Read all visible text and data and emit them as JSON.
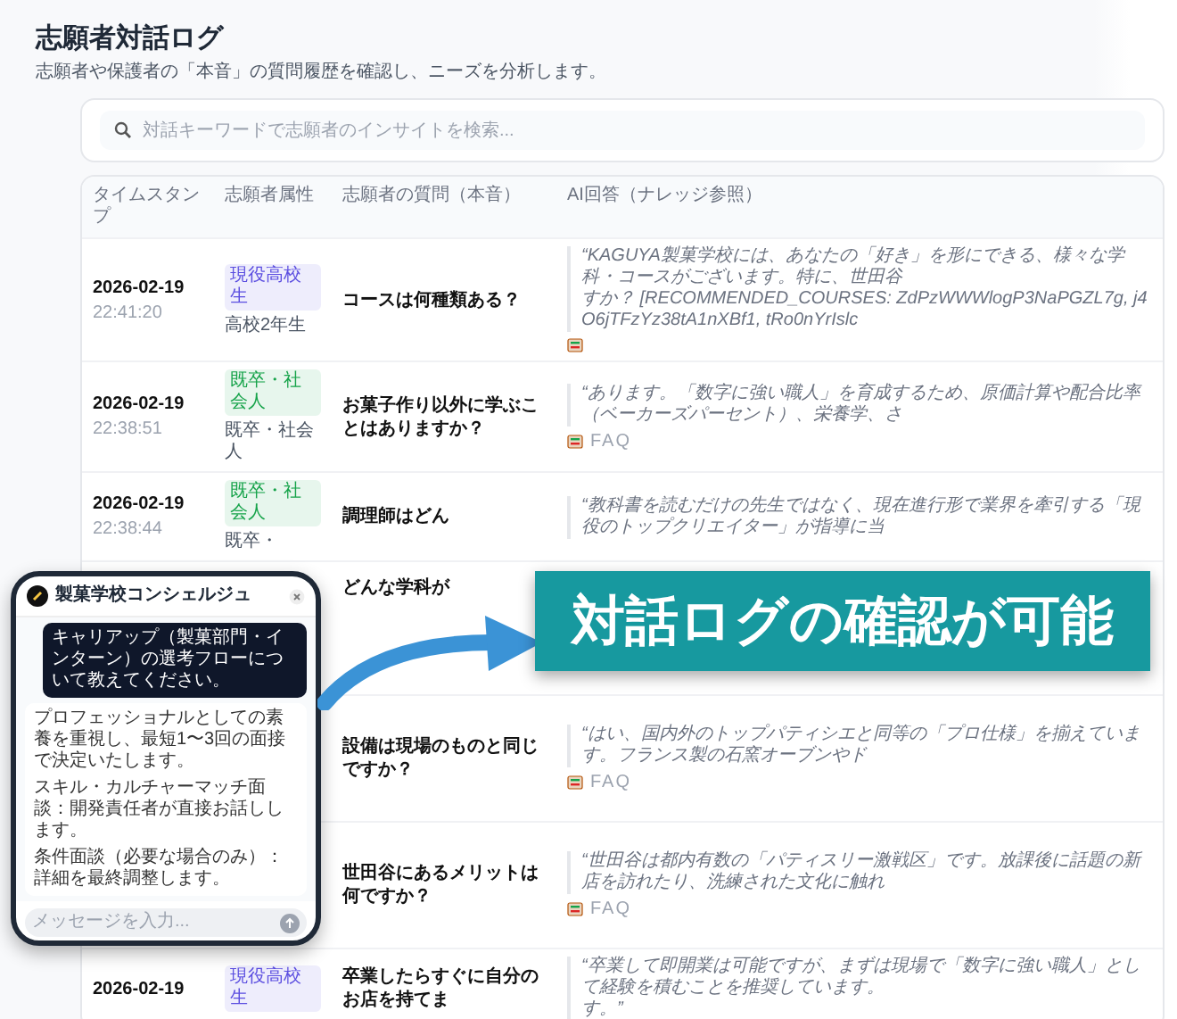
{
  "header": {
    "title": "志願者対話ログ",
    "subtitle": "志願者や保護者の「本音」の質問履歴を確認し、ニーズを分析します。"
  },
  "search": {
    "placeholder": "対話キーワードで志願者のインサイトを検索..."
  },
  "table": {
    "columns": [
      "タイムスタンプ",
      "志願者属性",
      "志願者の質問（本音）",
      "AI回答（ナレッジ参照）"
    ],
    "rows": [
      {
        "date": "2026-02-19",
        "time": "22:41:20",
        "tag": {
          "label": "現役高校生",
          "color": "#5b4ee0"
        },
        "attribute": "高校2年生",
        "question": "コースは何種類ある？",
        "answer": "“KAGUYA製菓学校には、あなたの「好き」を形にできる、様々な学科・コースがございます。特に、世田谷",
        "answer_2": "すか？ [RECOMMENDED_COURSES: ZdPzWWWlogP3NaPGZL7g, j4O6jTFzYz38tA1nXBf1, tRo0nYrIslc",
        "reference": true
      },
      {
        "date": "2026-02-19",
        "time": "22:38:51",
        "tag": {
          "label": "既卒・社会人",
          "color": "#16a34a"
        },
        "attribute": "既卒・社会人",
        "question": "お菓子作り以外に学ぶことはありますか？",
        "answer": "“あります。「数字に強い職人」を育成するため、原価計算や配合比率（ベーカーズパーセント）、栄養学、さ",
        "reference": true,
        "source": "FAQ"
      },
      {
        "date": "2026-02-19",
        "time": "22:38:44",
        "tag": {
          "label": "既卒・社会人",
          "color": "#16a34a"
        },
        "attribute": "既卒・",
        "question": "調理師はどん",
        "answer": "“教科書を読むだけの先生ではなく、現在進行形で業界を牽引する「現役のトップクリエイター」が指導に当"
      },
      {
        "question": "どんな学科が"
      },
      {
        "question": "設備は現場のものと同じですか？",
        "answer": "“はい、国内外のトップパティシエと同等の「プロ仕様」を揃えています。フランス製の石窯オーブンやド",
        "reference": true,
        "source": "FAQ"
      },
      {
        "question": "世田谷にあるメリットは何ですか？",
        "answer": "“世田谷は都内有数の「パティスリー激戦区」です。放課後に話題の新店を訪れたり、洗練された文化に触れ",
        "reference": true,
        "source": "FAQ"
      },
      {
        "date": "2026-02-19",
        "tag": {
          "label": "現役高校生",
          "color": "#5b4ee0"
        },
        "question": "卒業したらすぐに自分のお店を持てま",
        "answer": "“卒業して即開業は可能ですが、まずは現場で「数字に強い職人」として経験を積むことを推奨しています。",
        "answer_2": "す。”"
      }
    ]
  },
  "phone": {
    "title": "製菓学校コンシェルジュ",
    "user_message": "キャリアップ（製菓部門・インターン）の選考フローについて教えてください。",
    "paragraphs": [
      "プロフェッショナルとしての素養を重視し、最短1〜3回の面接で決定いたします。",
      "スキル・カルチャーマッチ面談：開発責任者が直接お話しします。",
      "条件面談（必要な場合のみ）：詳細を最終調整します。"
    ],
    "placeholder": "メッセージを入力..."
  },
  "banner": {
    "text": "対話ログの確認が可能"
  }
}
